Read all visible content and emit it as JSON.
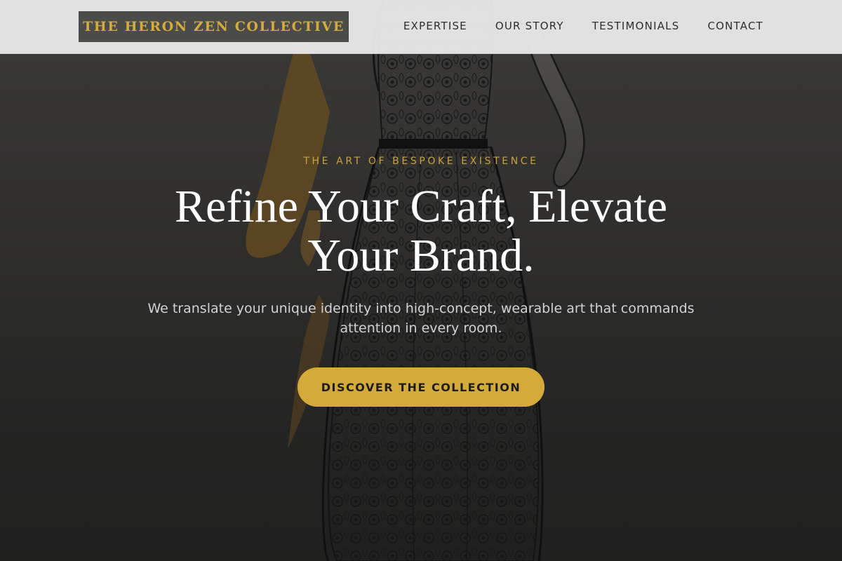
{
  "header": {
    "logo_text": "THE HERON ZEN COLLECTIVE",
    "nav": [
      {
        "label": "EXPERTISE"
      },
      {
        "label": "OUR STORY"
      },
      {
        "label": "TESTIMONIALS"
      },
      {
        "label": "CONTACT"
      }
    ]
  },
  "hero": {
    "eyebrow": "THE ART OF BESPOKE EXISTENCE",
    "headline": "Refine Your Craft, Elevate Your Brand.",
    "subheadline": "We translate your unique identity into high-concept, wearable art that commands attention in every room.",
    "cta_label": "DISCOVER THE COLLECTION",
    "background_image": "fashion-sketch-lace-gown-illustration"
  },
  "colors": {
    "accent_gold": "#d4ab3a",
    "header_bg": "#e8e8e8",
    "logo_bg": "#4b4b4a",
    "hero_text": "#ffffff",
    "subtext": "#d2d2d2"
  }
}
